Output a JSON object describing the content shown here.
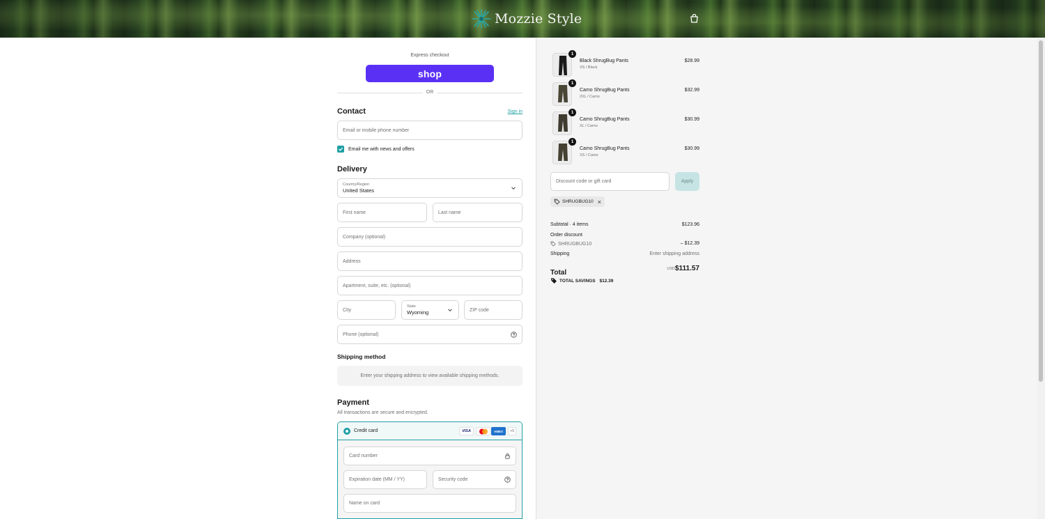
{
  "header": {
    "brand_name": "Mozzie Style",
    "logo_icon": "star-burst-logo",
    "cart_icon": "shopping-bag-icon"
  },
  "express": {
    "label": "Express checkout",
    "shop_button": "shop",
    "divider": "OR"
  },
  "contact": {
    "title": "Contact",
    "sign_in": "Sign in",
    "email_placeholder": "Email or mobile phone number",
    "newsletter_label": "Email me with news and offers",
    "newsletter_checked": true
  },
  "delivery": {
    "title": "Delivery",
    "country_label": "Country/Region",
    "country_value": "United States",
    "first_name": "First name",
    "last_name": "Last name",
    "company": "Company (optional)",
    "address": "Address",
    "apartment": "Apartment, suite, etc. (optional)",
    "city": "City",
    "state_label": "State",
    "state_value": "Wyoming",
    "zip": "ZIP code",
    "phone": "Phone (optional)"
  },
  "shipping": {
    "title": "Shipping method",
    "message": "Enter your shipping address to view available shipping methods."
  },
  "payment": {
    "title": "Payment",
    "subtitle": "All transactions are secure and encrypted.",
    "method_label": "Credit card",
    "card_logos": [
      "VISA",
      "MC",
      "AMEX",
      "+5"
    ],
    "card_number": "Card number",
    "expiration": "Expiration date (MM / YY)",
    "security_code": "Security code",
    "name_on_card": "Name on card"
  },
  "cart": {
    "items": [
      {
        "name": "Black ShrugBug Pants",
        "variant": "XS / Black",
        "price": "$28.99",
        "qty": "1",
        "color": "#1b1b1b"
      },
      {
        "name": "Camo ShrugBug Pants",
        "variant": "2XL / Camo",
        "price": "$32.99",
        "qty": "1",
        "color": "#4a4636"
      },
      {
        "name": "Camo ShrugBug Pants",
        "variant": "XL / Camo",
        "price": "$30.99",
        "qty": "1",
        "color": "#3f3b2e"
      },
      {
        "name": "Camo ShrugBug Pants",
        "variant": "XS / Camo",
        "price": "$30.99",
        "qty": "1",
        "color": "#454132"
      }
    ],
    "discount_placeholder": "Discount code or gift card",
    "apply_label": "Apply",
    "applied_code": "SHRUGBUG10"
  },
  "summary": {
    "subtotal_label": "Subtotal · 4 items",
    "subtotal_value": "$123.96",
    "order_discount_label": "Order discount",
    "discount_code": "SHRUGBUG10",
    "discount_value": "– $12.39",
    "shipping_label": "Shipping",
    "shipping_value": "Enter shipping address",
    "total_label": "Total",
    "currency": "USD",
    "total_value": "$111.57",
    "savings_label": "TOTAL SAVINGS",
    "savings_value": "$12.39"
  },
  "colors": {
    "accent": "#1e9fa4",
    "shop_purple": "#5a31f4"
  }
}
